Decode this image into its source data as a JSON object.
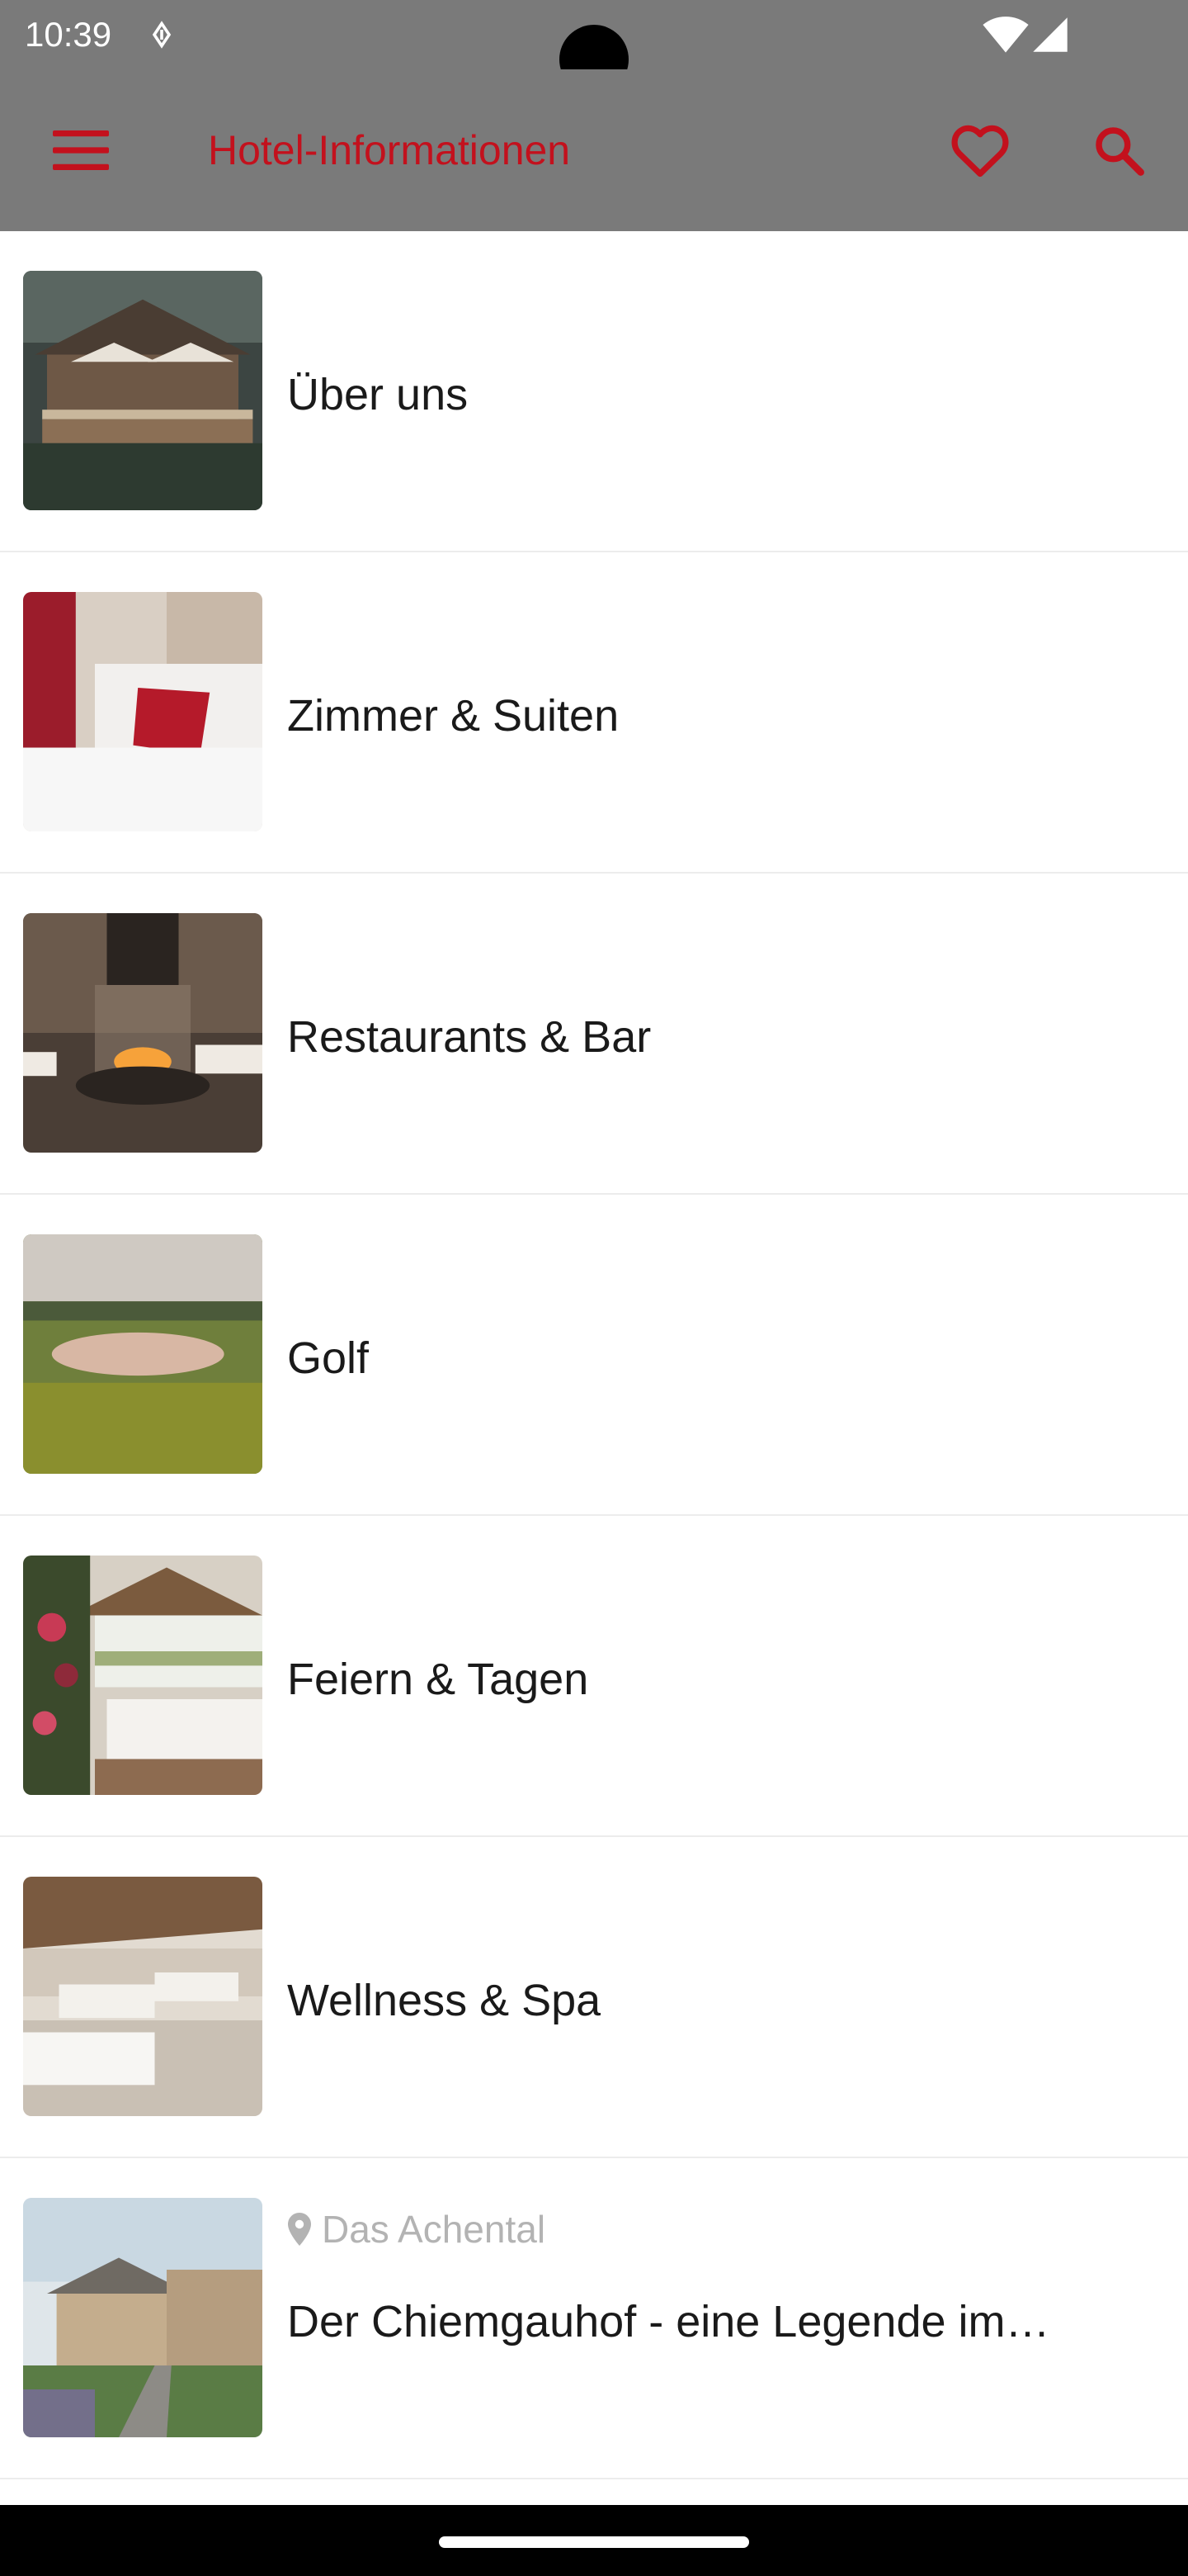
{
  "status_bar": {
    "time": "10:39",
    "icons": [
      "data-saver-icon",
      "wifi-icon",
      "battery-icon"
    ]
  },
  "app_bar": {
    "title": "Hotel-Informationen",
    "menu_icon": "menu-icon",
    "favorite_icon": "heart-icon",
    "search_icon": "search-icon"
  },
  "colors": {
    "accent": "#c3111d",
    "bar_background": "#7a7a7a",
    "subtitle": "#b3b3b3"
  },
  "items": [
    {
      "title": "Über uns",
      "image": "chalet-terrace-photo"
    },
    {
      "title": "Zimmer & Suiten",
      "image": "hotel-room-bed-photo"
    },
    {
      "title": "Restaurants & Bar",
      "image": "restaurant-fireplace-photo"
    },
    {
      "title": "Golf",
      "image": "golf-course-photo"
    },
    {
      "title": "Feiern & Tagen",
      "image": "banquet-hall-photo"
    },
    {
      "title": "Wellness & Spa",
      "image": "spa-relaxation-room-photo"
    },
    {
      "title": "Der Chiemgauhof - eine Legende im…",
      "subtitle": "Das Achental",
      "image": "chiemgauhof-building-photo"
    }
  ]
}
